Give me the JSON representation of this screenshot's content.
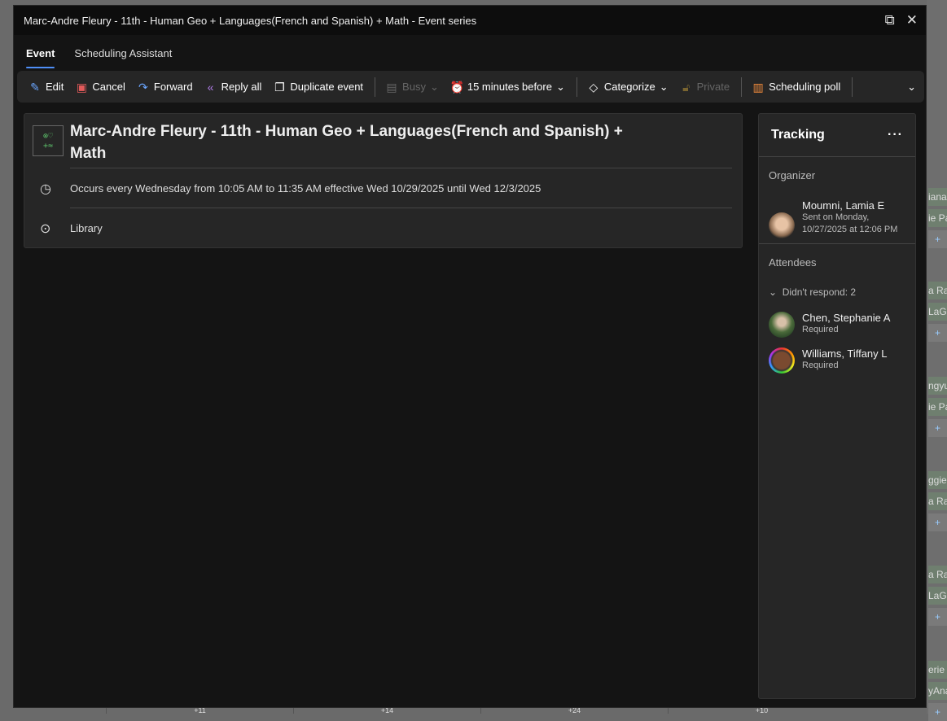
{
  "window": {
    "title": "Marc-Andre Fleury - 11th - Human Geo + Languages(French and Spanish) + Math - Event series"
  },
  "tabs": [
    {
      "label": "Event"
    },
    {
      "label": "Scheduling Assistant"
    }
  ],
  "toolbar": {
    "edit": "Edit",
    "cancel": "Cancel",
    "forward": "Forward",
    "reply_all": "Reply all",
    "duplicate": "Duplicate event",
    "busy": "Busy",
    "reminder": "15 minutes before",
    "categorize": "Categorize",
    "private": "Private",
    "scheduling_poll": "Scheduling poll"
  },
  "event": {
    "title": "Marc-Andre Fleury - 11th - Human Geo + Languages(French and Spanish) + Math",
    "recurrence": "Occurs every Wednesday from 10:05 AM to 11:35 AM effective Wed 10/29/2025 until Wed 12/3/2025",
    "location": "Library"
  },
  "tracking": {
    "title": "Tracking",
    "organizer_label": "Organizer",
    "organizer": {
      "name": "Moumni, Lamia E",
      "sent": "Sent on Monday, 10/27/2025 at 12:06 PM"
    },
    "attendees_label": "Attendees",
    "group": "Didn't respond: 2",
    "attendees": [
      {
        "name": "Chen, Stephanie A",
        "role": "Required"
      },
      {
        "name": "Williams, Tiffany L",
        "role": "Required"
      }
    ]
  },
  "background": {
    "chips": [
      "iana",
      "ie Pa",
      "+",
      "a Ra",
      "LaGr",
      "+",
      "ngyu",
      "ie Pa",
      "+",
      "ggie",
      "a Ra",
      "+",
      "a Ra",
      "LaGr",
      "+",
      "erie Y",
      "yAna",
      "+"
    ],
    "bottom": [
      "+11",
      "+14",
      "+24",
      "+10"
    ]
  }
}
